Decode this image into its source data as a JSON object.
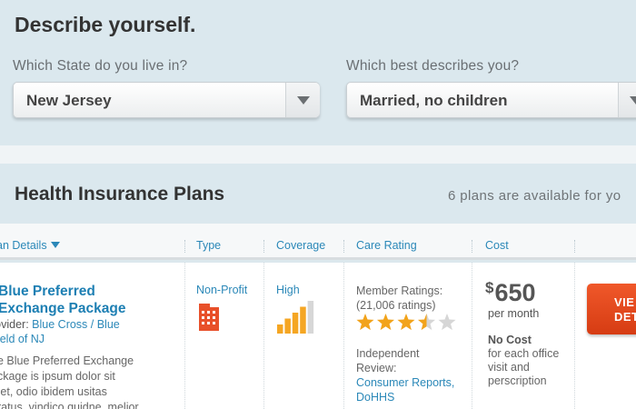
{
  "profile": {
    "title": "Describe yourself.",
    "state_question": "Which State do you live in?",
    "state_value": "New Jersey",
    "describe_question": "Which best describes you?",
    "describe_value": "Married, no children"
  },
  "plans": {
    "title": "Health Insurance Plans",
    "count_text": "6 plans are available for yo",
    "columns": {
      "plan_details": "an Details",
      "type": "Type",
      "coverage": "Coverage",
      "care_rating": "Care Rating",
      "cost": "Cost"
    },
    "rows": [
      {
        "name_line1": "Blue Preferred",
        "name_line2": "Exchange Package",
        "provider_label": "rovider:",
        "provider_line1": "Blue Cross / Blue",
        "provider_line2": "hield of NJ",
        "desc_line1": "he Blue Preferred Exchange",
        "desc_line2": "ackage is ipsum dolor sit",
        "desc_line3": "met, odio ibidem usitas",
        "desc_line4": "aratus, vindico quidne, melior",
        "type": "Non-Profit",
        "type_icon": "building-icon",
        "coverage": "High",
        "coverage_level": 4,
        "coverage_max": 5,
        "member_ratings_label": "Member Ratings:",
        "member_ratings_count": "(21,006 ratings)",
        "star_rating": 3.5,
        "star_max": 5,
        "independent_label1": "Independent",
        "independent_label2": "Review:",
        "review_source1": "Consumer Reports,",
        "review_source2": "DoHHS",
        "price_currency": "$",
        "price_value": "650",
        "price_period": "per month",
        "office_cost": "No Cost",
        "office_desc": "for each office visit and perscription",
        "button_line1": "VIE",
        "button_line2": "DETA"
      }
    ]
  },
  "colors": {
    "accent_blue": "#2b88b8",
    "button_orange": "#e0461a",
    "coverage_bar": "#f5a623",
    "star_gold": "#f2a31b"
  }
}
